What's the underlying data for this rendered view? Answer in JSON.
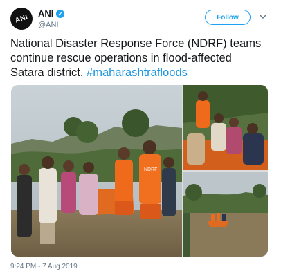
{
  "account": {
    "name": "ANI",
    "handle": "@ANI",
    "avatar_text": "ANI"
  },
  "follow": {
    "label": "Follow"
  },
  "tweet": {
    "text": "National Disaster Response Force (NDRF) teams continue rescue operations in flood-affected Satara district. ",
    "hashtag": "#maharashtrafloods",
    "timestamp": "9:24 PM - 7 Aug 2019"
  },
  "photos": {
    "vest_label": "NDRF"
  },
  "colors": {
    "accent": "#1da1f2",
    "text": "#14171a",
    "muted": "#657786"
  }
}
